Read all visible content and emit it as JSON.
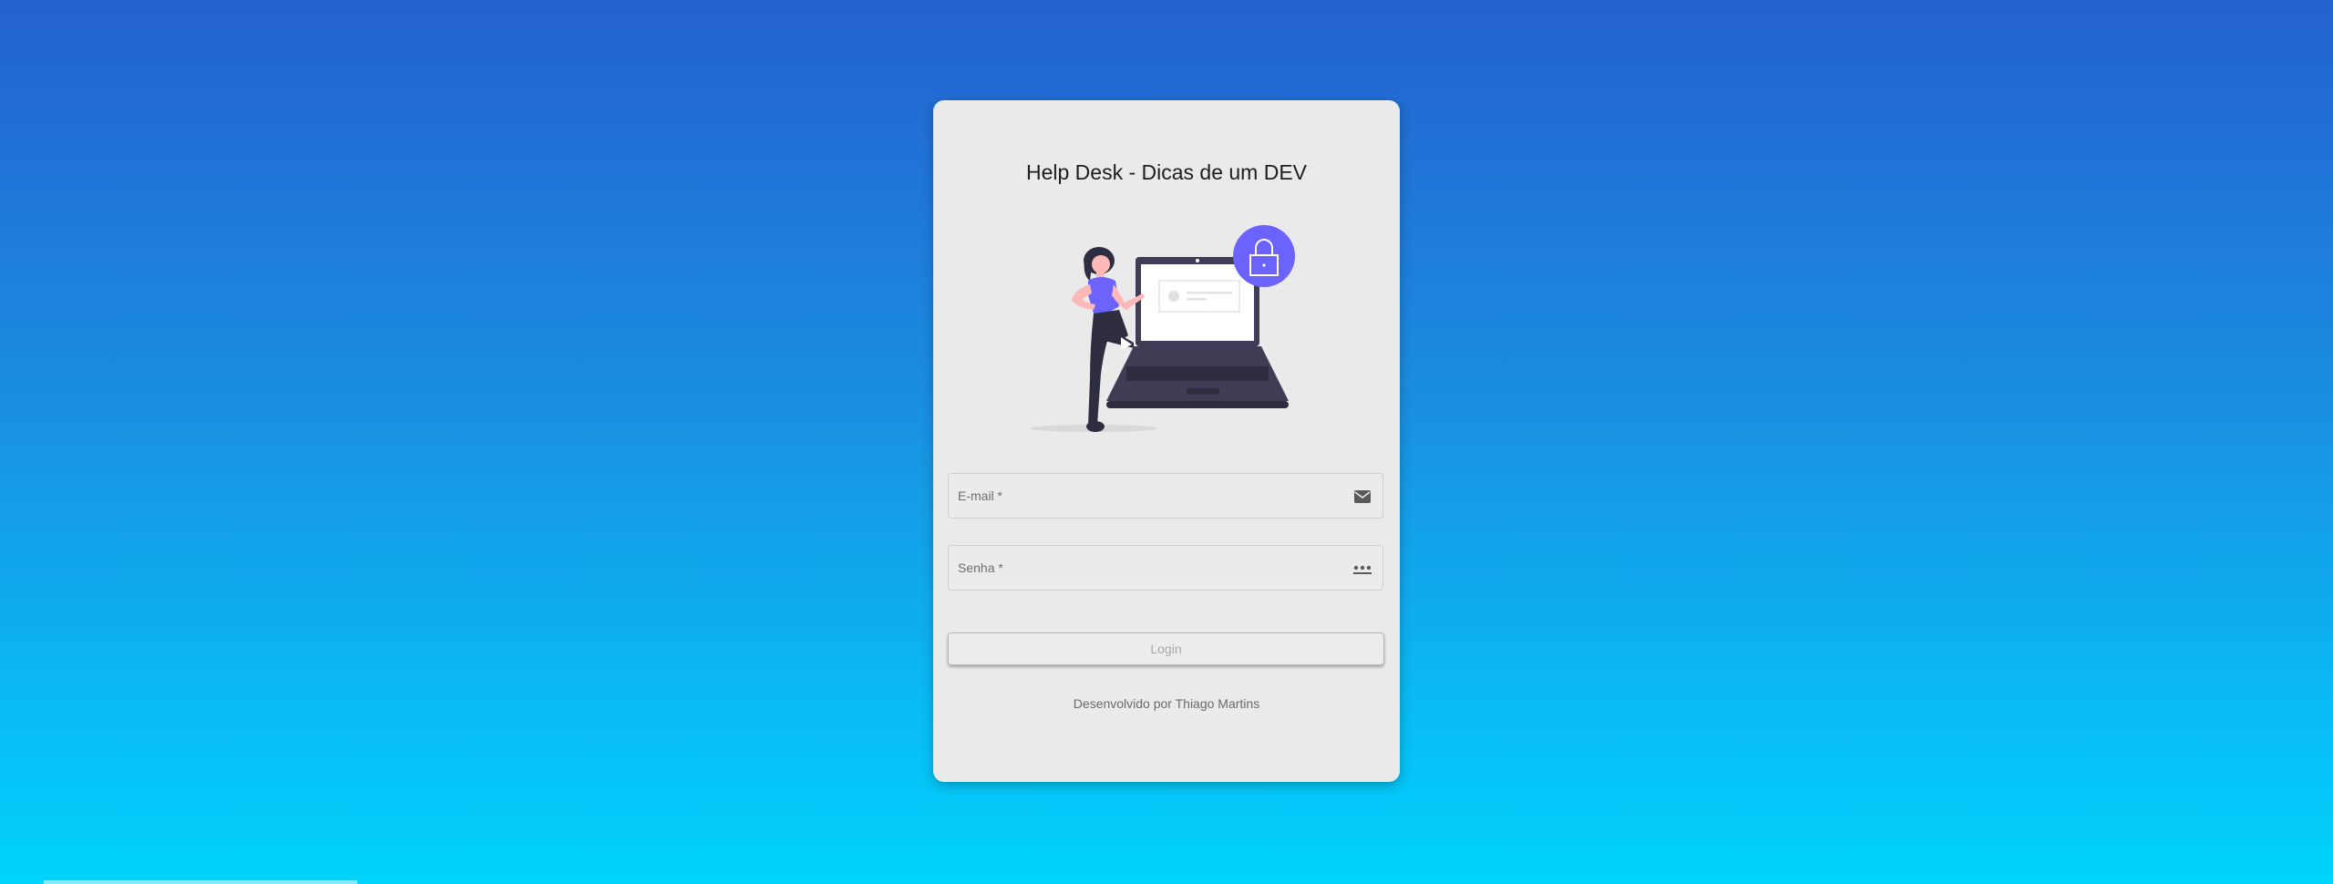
{
  "app": {
    "title": "Help Desk - Dicas de um DEV"
  },
  "form": {
    "email_placeholder": "E-mail *",
    "email_value": "",
    "email_icon": "mail-icon",
    "password_placeholder": "Senha *",
    "password_value": "",
    "password_icon": "password-dots-icon",
    "login_label": "Login"
  },
  "footer": {
    "credit": "Desenvolvido por Thiago Martins"
  },
  "colors": {
    "gradient_top": "#2461d0",
    "gradient_bottom": "#00d4fe",
    "card_background": "#eaeaea",
    "accent_purple": "#6c63ff",
    "laptop_dark": "#3f3d56"
  },
  "illustration": {
    "icon": "lock-icon"
  }
}
